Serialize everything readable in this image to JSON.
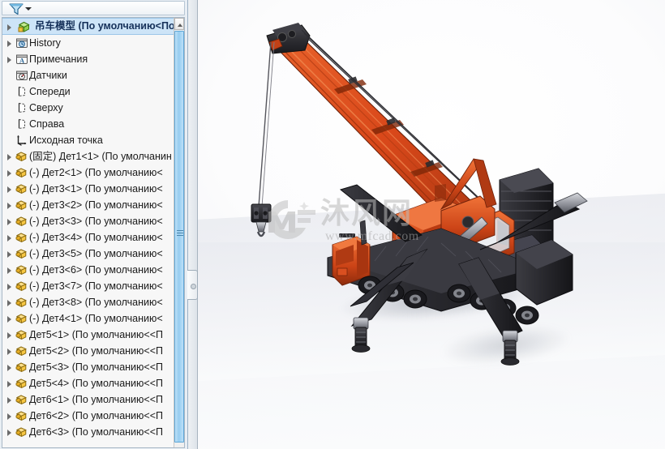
{
  "panel": {
    "filter": {
      "icon": "filter-funnel-icon",
      "dropdown_icon": "chevron-down-icon"
    },
    "scrollbar": {
      "up_arrow_icon": "scroll-up-arrow-icon"
    },
    "splitter": {
      "grip_icon": "splitter-grip-icon"
    }
  },
  "tree": {
    "root": {
      "label": "吊车模型  (По умолчанию<По умо",
      "icon": "assembly-icon",
      "expandable": true
    },
    "items": [
      {
        "label": "History",
        "icon": "history-icon",
        "expandable": true,
        "indent": 1
      },
      {
        "label": "Примечания",
        "icon": "annotations-icon",
        "expandable": true,
        "indent": 1
      },
      {
        "label": "Датчики",
        "icon": "sensors-icon",
        "expandable": false,
        "indent": 1
      },
      {
        "label": "Спереди",
        "icon": "plane-icon",
        "expandable": false,
        "indent": 1
      },
      {
        "label": "Сверху",
        "icon": "plane-icon",
        "expandable": false,
        "indent": 1
      },
      {
        "label": "Справа",
        "icon": "plane-icon",
        "expandable": false,
        "indent": 1
      },
      {
        "label": "Исходная точка",
        "icon": "origin-icon",
        "expandable": false,
        "indent": 1
      },
      {
        "label": "(固定) Дет1<1> (По умолчанин",
        "icon": "part-icon",
        "expandable": true,
        "indent": 1
      },
      {
        "label": "(-) Дет2<1> (По умолчанию<",
        "icon": "part-icon",
        "expandable": true,
        "indent": 1
      },
      {
        "label": "(-) Дет3<1> (По умолчанию<",
        "icon": "part-icon",
        "expandable": true,
        "indent": 1
      },
      {
        "label": "(-) Дет3<2> (По умолчанию<",
        "icon": "part-icon",
        "expandable": true,
        "indent": 1
      },
      {
        "label": "(-) Дет3<3> (По умолчанию<",
        "icon": "part-icon",
        "expandable": true,
        "indent": 1
      },
      {
        "label": "(-) Дет3<4> (По умолчанию<",
        "icon": "part-icon",
        "expandable": true,
        "indent": 1
      },
      {
        "label": "(-) Дет3<5> (По умолчанию<",
        "icon": "part-icon",
        "expandable": true,
        "indent": 1
      },
      {
        "label": "(-) Дет3<6> (По умолчанию<",
        "icon": "part-icon",
        "expandable": true,
        "indent": 1
      },
      {
        "label": "(-) Дет3<7> (По умолчанию<",
        "icon": "part-icon",
        "expandable": true,
        "indent": 1
      },
      {
        "label": "(-) Дет3<8> (По умолчанию<",
        "icon": "part-icon",
        "expandable": true,
        "indent": 1
      },
      {
        "label": "(-) Дет4<1> (По умолчанию<",
        "icon": "part-icon",
        "expandable": true,
        "indent": 1
      },
      {
        "label": "Дет5<1> (По умолчанию<<П",
        "icon": "part-icon",
        "expandable": true,
        "indent": 1
      },
      {
        "label": "Дет5<2> (По умолчанию<<П",
        "icon": "part-icon",
        "expandable": true,
        "indent": 1
      },
      {
        "label": "Дет5<3> (По умолчанию<<П",
        "icon": "part-icon",
        "expandable": true,
        "indent": 1
      },
      {
        "label": "Дет5<4> (По умолчанию<<П",
        "icon": "part-icon",
        "expandable": true,
        "indent": 1
      },
      {
        "label": "Дет6<1> (По умолчанию<<П",
        "icon": "part-icon",
        "expandable": true,
        "indent": 1
      },
      {
        "label": "Дет6<2> (По умолчанию<<П",
        "icon": "part-icon",
        "expandable": true,
        "indent": 1
      },
      {
        "label": "Дет6<3> (По умолчанию<<П",
        "icon": "part-icon",
        "expandable": true,
        "indent": 1
      }
    ]
  },
  "viewport": {
    "model_name": "mobile-crane-3d-model",
    "watermark": {
      "brand": "沐风网",
      "url": "www.mfcad.com",
      "logo": "mf-logo-icon"
    }
  },
  "colors": {
    "crane_orange": "#d9481a",
    "crane_orange_dark": "#a6330f",
    "crane_black": "#2b2b2e",
    "crane_black_light": "#3d3d42",
    "selection_blue": "#cde4f7",
    "scrollbar_blue": "#96cdf0",
    "panel_bg": "#e8eef4"
  }
}
